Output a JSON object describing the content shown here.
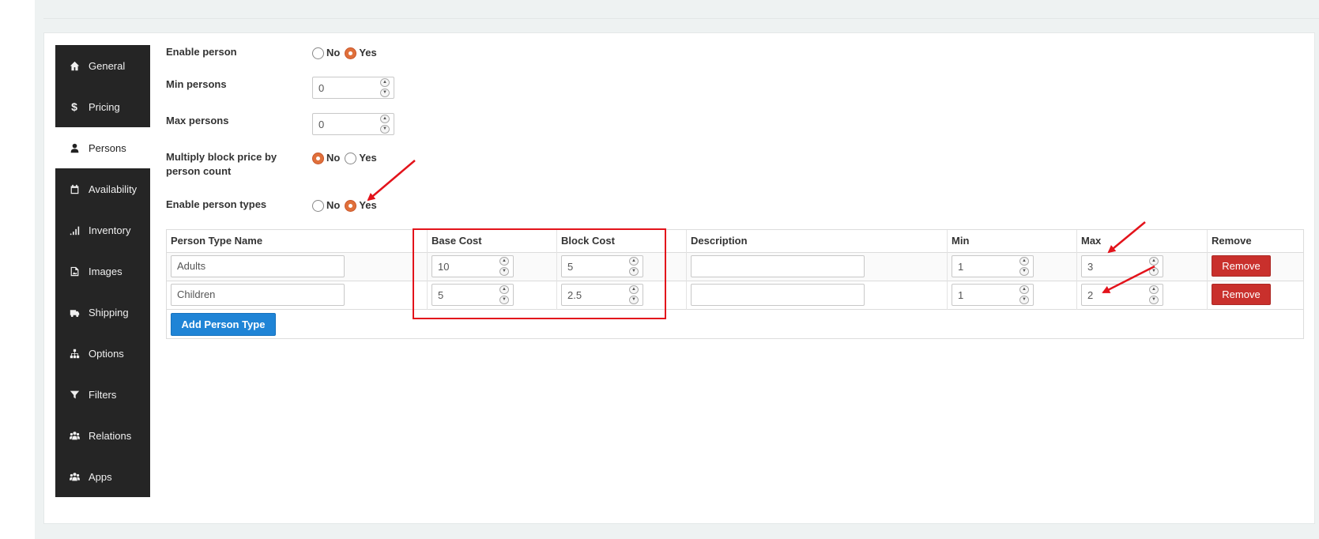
{
  "sidebar": {
    "items": [
      {
        "label": "General",
        "icon": "home-icon"
      },
      {
        "label": "Pricing",
        "icon": "dollar-icon"
      },
      {
        "label": "Persons",
        "icon": "user-icon",
        "active": true
      },
      {
        "label": "Availability",
        "icon": "calendar-icon"
      },
      {
        "label": "Inventory",
        "icon": "signal-icon"
      },
      {
        "label": "Images",
        "icon": "image-file-icon"
      },
      {
        "label": "Shipping",
        "icon": "truck-icon"
      },
      {
        "label": "Options",
        "icon": "sitemap-icon"
      },
      {
        "label": "Filters",
        "icon": "filter-icon"
      },
      {
        "label": "Relations",
        "icon": "users-icon"
      },
      {
        "label": "Apps",
        "icon": "users-icon"
      }
    ]
  },
  "form": {
    "enable_person": {
      "label": "Enable person",
      "no": "No",
      "yes": "Yes",
      "selected": "Yes"
    },
    "min_persons": {
      "label": "Min persons",
      "value": "0"
    },
    "max_persons": {
      "label": "Max persons",
      "value": "0"
    },
    "multiply": {
      "label_line1": "Multiply block price by",
      "label_line2": "person count",
      "no": "No",
      "yes": "Yes",
      "selected": "No"
    },
    "enable_types": {
      "label": "Enable person types",
      "no": "No",
      "yes": "Yes",
      "selected": "Yes"
    }
  },
  "table": {
    "headers": {
      "name": "Person Type Name",
      "base_cost": "Base Cost",
      "block_cost": "Block Cost",
      "description": "Description",
      "min": "Min",
      "max": "Max",
      "remove": "Remove"
    },
    "rows": [
      {
        "name": "Adults",
        "base_cost": "10",
        "block_cost": "5",
        "description": "",
        "min": "1",
        "max": "3",
        "remove_label": "Remove"
      },
      {
        "name": "Children",
        "base_cost": "5",
        "block_cost": "2.5",
        "description": "",
        "min": "1",
        "max": "2",
        "remove_label": "Remove"
      }
    ],
    "add_button": "Add Person Type"
  },
  "colors": {
    "sidebar_bg": "#252525",
    "radio_checked": "#e0703b",
    "remove_button": "#c9302c",
    "add_button": "#1f84d6",
    "annotation_red": "#e3131b"
  }
}
